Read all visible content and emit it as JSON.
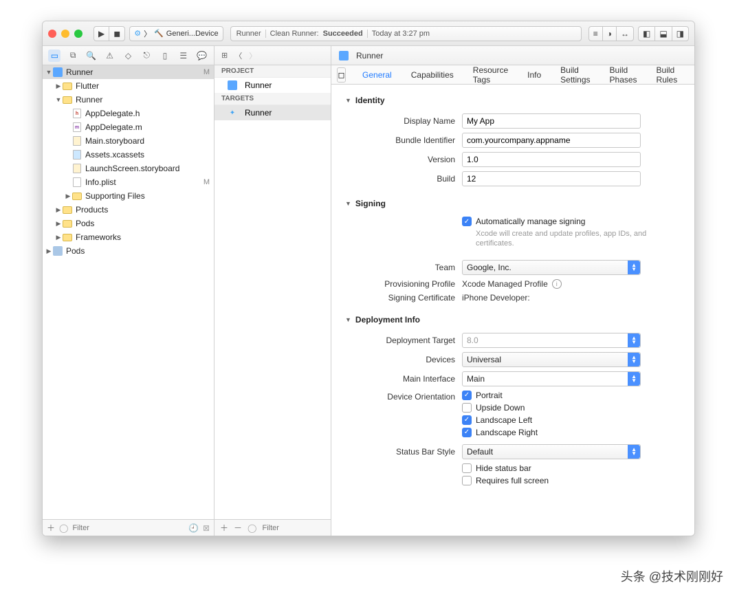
{
  "toolbar": {
    "scheme_left": "Generi...Device",
    "status_app": "Runner",
    "status_action": "Clean Runner:",
    "status_result": "Succeeded",
    "status_time": "Today at 3:27 pm"
  },
  "navpath": {
    "file": "Runner"
  },
  "tree": {
    "root": "Runner",
    "root_badge": "M",
    "flutter": "Flutter",
    "runner": "Runner",
    "appdelegate_h": "AppDelegate.h",
    "appdelegate_m": "AppDelegate.m",
    "main_sb": "Main.storyboard",
    "assets": "Assets.xcassets",
    "launch_sb": "LaunchScreen.storyboard",
    "info_plist": "Info.plist",
    "info_plist_badge": "M",
    "supporting": "Supporting Files",
    "products": "Products",
    "pods": "Pods",
    "frameworks": "Frameworks",
    "pods_ext": "Pods",
    "filter_ph": "Filter"
  },
  "pt": {
    "project_h": "PROJECT",
    "project": "Runner",
    "targets_h": "TARGETS",
    "target": "Runner",
    "filter_ph": "Filter"
  },
  "tabs": {
    "general": "General",
    "capabilities": "Capabilities",
    "resource_tags": "Resource Tags",
    "info": "Info",
    "build_settings": "Build Settings",
    "build_phases": "Build Phases",
    "build_rules": "Build Rules"
  },
  "identity": {
    "header": "Identity",
    "display_name_l": "Display Name",
    "display_name": "My App",
    "bundle_id_l": "Bundle Identifier",
    "bundle_id": "com.yourcompany.appname",
    "version_l": "Version",
    "version": "1.0",
    "build_l": "Build",
    "build": "12"
  },
  "signing": {
    "header": "Signing",
    "auto_l": "Automatically manage signing",
    "auto_sub": "Xcode will create and update profiles, app IDs, and certificates.",
    "team_l": "Team",
    "team": "Google, Inc.",
    "profile_l": "Provisioning Profile",
    "profile": "Xcode Managed Profile",
    "cert_l": "Signing Certificate",
    "cert": "iPhone Developer:"
  },
  "deploy": {
    "header": "Deployment Info",
    "target_l": "Deployment Target",
    "target": "8.0",
    "devices_l": "Devices",
    "devices": "Universal",
    "main_if_l": "Main Interface",
    "main_if": "Main",
    "orient_l": "Device Orientation",
    "portrait": "Portrait",
    "upside": "Upside Down",
    "land_l": "Landscape Left",
    "land_r": "Landscape Right",
    "status_l": "Status Bar Style",
    "status": "Default",
    "hide_sb": "Hide status bar",
    "req_fs": "Requires full screen"
  },
  "watermark": "头条 @技术刚刚好"
}
